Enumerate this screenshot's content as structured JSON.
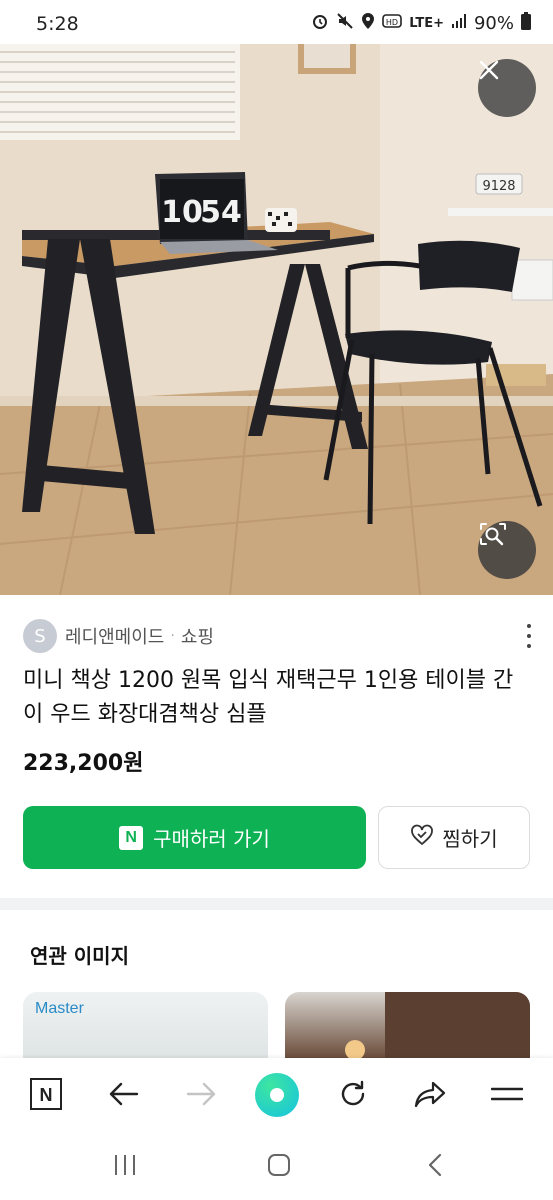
{
  "status": {
    "time": "5:28",
    "network": "LTE+",
    "battery": "90%",
    "icons": [
      "alarm-icon",
      "mute-icon",
      "location-icon",
      "hd-icon",
      "lte-icon",
      "signal-icon",
      "battery-icon"
    ]
  },
  "hero": {
    "clock_hours": "10",
    "clock_minutes": "54",
    "small_clock": "9128",
    "icons": [
      "close-icon",
      "image-search-icon"
    ]
  },
  "seller": {
    "avatar_letter": "S",
    "name": "레디앤메이드",
    "separator": "·",
    "category": "쇼핑"
  },
  "product": {
    "title": "미니 책상 1200 원목 입식 재택근무 1인용 테이블 간이 우드 화장대겸책상 심플",
    "price": "223,200원"
  },
  "actions": {
    "buy_badge": "N",
    "buy_label": "구매하러 가기",
    "wish_label": "찜하기"
  },
  "related": {
    "title": "연관 이미지",
    "thumb1_label": "Master"
  },
  "toolbar": {
    "n_label": "N",
    "icons": [
      "naver-n-icon",
      "back-arrow-icon",
      "forward-arrow-icon",
      "home-dot-icon",
      "reload-icon",
      "share-icon",
      "menu-icon"
    ]
  },
  "nav": {
    "icons": [
      "recents-icon",
      "home-icon",
      "back-icon"
    ]
  },
  "colors": {
    "buy_green": "#0eb254",
    "divider_gray": "#f1f2f4"
  }
}
